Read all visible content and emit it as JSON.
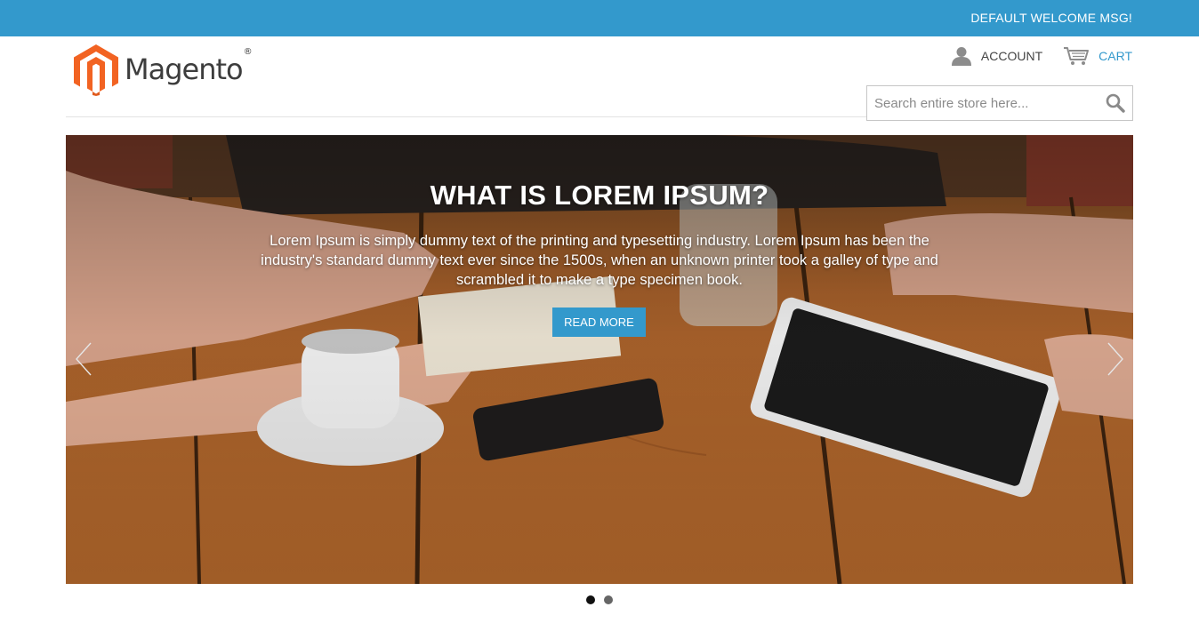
{
  "topbar": {
    "welcome_message": "DEFAULT WELCOME MSG!",
    "background_color": "#3399cc"
  },
  "logo": {
    "text": "Magento",
    "registered_mark": "®",
    "brand_color": "#f26322"
  },
  "header_links": {
    "account_label": "ACCOUNT",
    "account_icon": "user-icon",
    "cart_label": "CART",
    "cart_icon": "cart-icon"
  },
  "search": {
    "placeholder": "Search entire store here...",
    "value": "",
    "icon": "search-icon"
  },
  "hero": {
    "title": "WHAT IS LOREM IPSUM?",
    "text": "Lorem Ipsum is simply dummy text of the printing and typesetting industry. Lorem Ipsum has been the industry's standard dummy text ever since the 1500s, when an unknown printer took a galley of type and scrambled it to make a type specimen book.",
    "button_label": "READ MORE",
    "button_color": "#3399cc",
    "prev_icon": "chevron-left-icon",
    "next_icon": "chevron-right-icon"
  },
  "slider": {
    "total_slides": 2,
    "active_slide": 1
  }
}
